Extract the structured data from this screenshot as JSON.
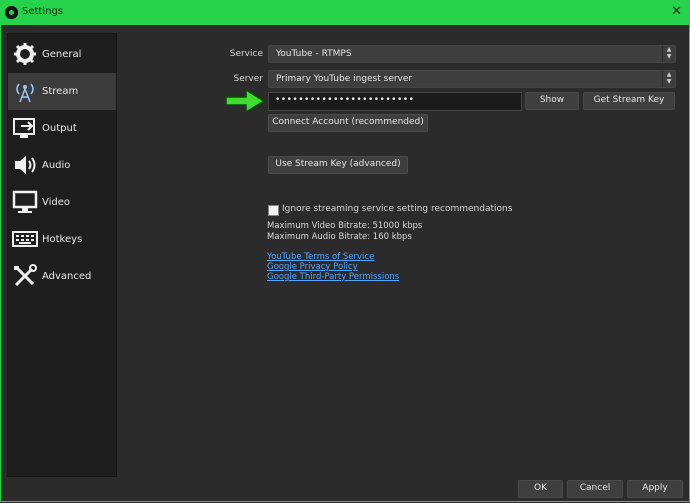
{
  "window": {
    "title": "Settings",
    "close_glyph": "✕"
  },
  "sidebar": {
    "items": [
      {
        "label": "General",
        "icon": "gear-icon"
      },
      {
        "label": "Stream",
        "icon": "broadcast-icon",
        "active": true
      },
      {
        "label": "Output",
        "icon": "output-icon"
      },
      {
        "label": "Audio",
        "icon": "speaker-icon"
      },
      {
        "label": "Video",
        "icon": "monitor-icon"
      },
      {
        "label": "Hotkeys",
        "icon": "keyboard-icon"
      },
      {
        "label": "Advanced",
        "icon": "tools-icon"
      }
    ]
  },
  "stream": {
    "service_label": "Service",
    "service_value": "YouTube - RTMPS",
    "server_label": "Server",
    "server_value": "Primary YouTube ingest server",
    "stream_key_value": "••••••••••••••••••••••••",
    "show_button": "Show",
    "get_stream_key_button": "Get Stream Key",
    "connect_account_button": "Connect Account (recommended)",
    "use_stream_key_button": "Use Stream Key (advanced)",
    "ignore_checkbox_label": "Ignore streaming service setting recommendations",
    "max_video_bitrate": "Maximum Video Bitrate: 51000 kbps",
    "max_audio_bitrate": "Maximum Audio Bitrate: 160 kbps",
    "links": [
      "YouTube Terms of Service",
      "Google Privacy Policy",
      "Google Third-Party Permissions"
    ]
  },
  "footer": {
    "ok": "OK",
    "cancel": "Cancel",
    "apply": "Apply"
  },
  "colors": {
    "accent": "#25d24a",
    "link": "#53a6ff"
  }
}
